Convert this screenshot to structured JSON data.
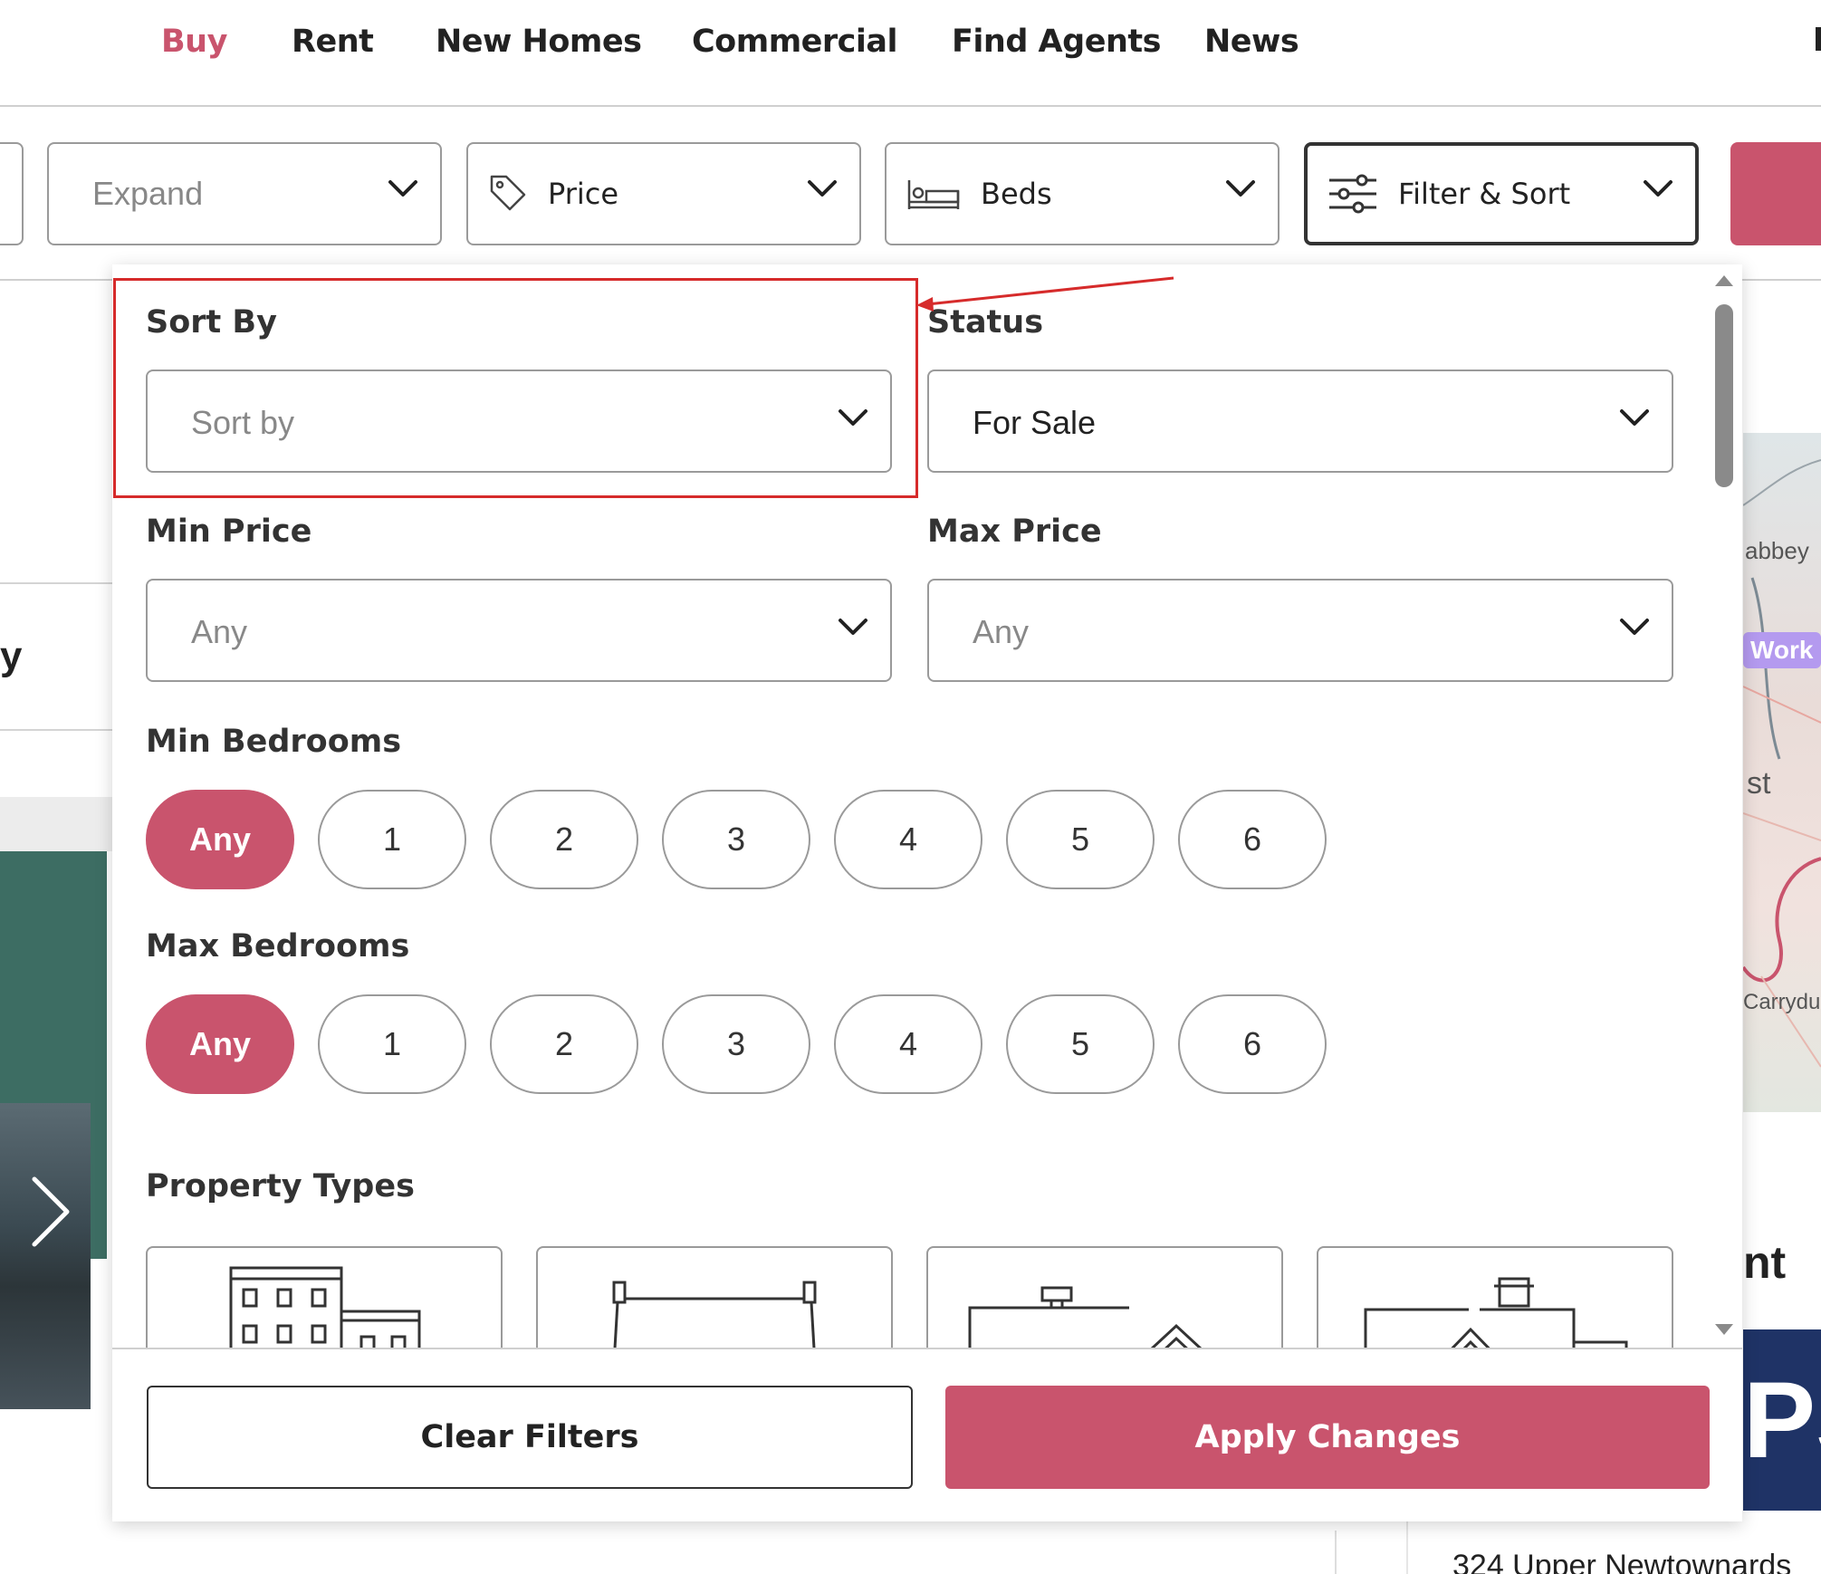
{
  "nav": {
    "items": [
      {
        "label": "Buy",
        "active": true
      },
      {
        "label": "Rent",
        "active": false
      },
      {
        "label": "New Homes",
        "active": false
      },
      {
        "label": "Commercial",
        "active": false
      },
      {
        "label": "Find Agents",
        "active": false
      },
      {
        "label": "News",
        "active": false
      }
    ]
  },
  "filterbar": {
    "expand_placeholder": "Expand",
    "price_label": "Price",
    "beds_label": "Beds",
    "filter_sort_label": "Filter & Sort"
  },
  "panel": {
    "sort_by": {
      "label": "Sort By",
      "placeholder": "Sort by"
    },
    "status": {
      "label": "Status",
      "value": "For Sale"
    },
    "min_price": {
      "label": "Min Price",
      "placeholder": "Any"
    },
    "max_price": {
      "label": "Max Price",
      "placeholder": "Any"
    },
    "min_bedrooms": {
      "label": "Min Bedrooms",
      "options": [
        "Any",
        "1",
        "2",
        "3",
        "4",
        "5",
        "6"
      ],
      "selected": "Any"
    },
    "max_bedrooms": {
      "label": "Max Bedrooms",
      "options": [
        "Any",
        "1",
        "2",
        "3",
        "4",
        "5",
        "6"
      ],
      "selected": "Any"
    },
    "property_types": {
      "label": "Property Types",
      "icons": [
        "apartment-icon",
        "terrace-icon",
        "semi-detached-icon",
        "detached-icon"
      ]
    },
    "clear_label": "Clear Filters",
    "apply_label": "Apply Changes"
  },
  "background": {
    "map_labels": [
      "abbey",
      "Work",
      "st",
      "Carrydu"
    ],
    "heading_fragment": "nt",
    "logo_fragment": "PS",
    "address_fragment": "324 Upper Newtownards",
    "left_fragment": "y"
  },
  "colors": {
    "accent": "#c9546d",
    "annotation": "#d62b2b",
    "border": "#9a9a9a"
  }
}
